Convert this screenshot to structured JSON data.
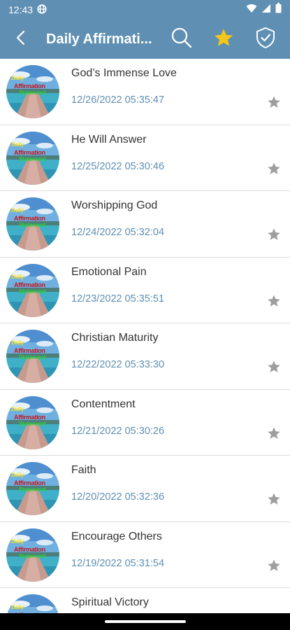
{
  "status_bar": {
    "time": "12:43",
    "icons": [
      "vpn-globe-icon",
      "wifi-icon",
      "signal-icon",
      "battery-icon"
    ]
  },
  "app_bar": {
    "title": "Daily Affirmati...",
    "back_icon": "back-arrow-icon",
    "actions": [
      "search-icon",
      "favorite-star-icon",
      "shield-check-icon"
    ],
    "favorite_color": "#f5c518"
  },
  "thumbnail_caption": [
    "Daily",
    "Affirmation",
    "Statement"
  ],
  "items": [
    {
      "title": "God’s Immense Love",
      "date": "12/26/2022 05:35:47"
    },
    {
      "title": "He Will Answer",
      "date": "12/25/2022 05:30:46"
    },
    {
      "title": "Worshipping God",
      "date": "12/24/2022 05:32:04"
    },
    {
      "title": "Emotional Pain",
      "date": "12/23/2022 05:35:51"
    },
    {
      "title": "Christian Maturity",
      "date": "12/22/2022 05:33:30"
    },
    {
      "title": "Contentment",
      "date": "12/21/2022 05:30:26"
    },
    {
      "title": "Faith",
      "date": "12/20/2022 05:32:36"
    },
    {
      "title": "Encourage Others",
      "date": "12/19/2022 05:31:54"
    },
    {
      "title": "Spiritual Victory",
      "date": ""
    }
  ],
  "colors": {
    "primary": "#5f8fb2",
    "star_inactive": "#9e9e9e"
  }
}
